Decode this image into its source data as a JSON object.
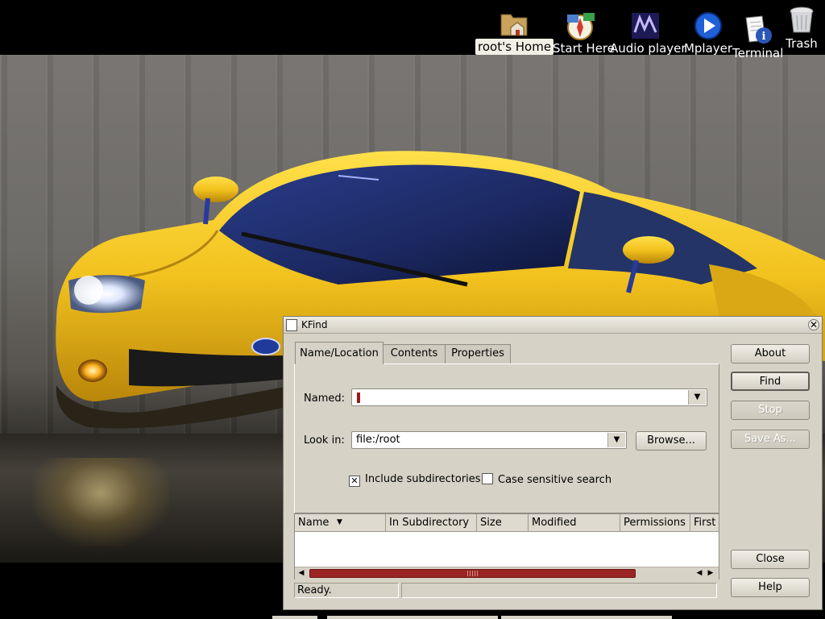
{
  "desktop": {
    "icons": [
      {
        "label": "root's Home",
        "icon": "home-folder-icon",
        "selected": true
      },
      {
        "label": "Start Here",
        "icon": "compass-icon"
      },
      {
        "label": "Audio player",
        "icon": "mms-icon"
      },
      {
        "label": "Mplayer",
        "icon": "play-icon"
      },
      {
        "label": "Terminal",
        "icon": "info-doc-icon"
      },
      {
        "label": "Trash",
        "icon": "trash-icon"
      }
    ]
  },
  "window": {
    "title": "KFind",
    "tabs": [
      {
        "label": "Name/Location",
        "active": true
      },
      {
        "label": "Contents"
      },
      {
        "label": "Properties"
      }
    ],
    "named_label": "Named:",
    "named_value": "",
    "lookin_label": "Look in:",
    "lookin_value": "file:/root",
    "browse_label": "Browse...",
    "include_subdirs": {
      "label": "Include subdirectories",
      "checked": true
    },
    "case_sensitive": {
      "label": "Case sensitive search",
      "checked": false
    },
    "buttons": {
      "about": "About",
      "find": "Find",
      "stop": "Stop",
      "save_as": "Save As...",
      "close": "Close",
      "help": "Help"
    },
    "results_columns": [
      "Name",
      "In Subdirectory",
      "Size",
      "Modified",
      "Permissions",
      "First"
    ],
    "status_text": "Ready."
  },
  "colors": {
    "window_bg": "#d6d2c6",
    "scroll_thumb": "#9b2424",
    "car_yellow": "#f0c020"
  }
}
